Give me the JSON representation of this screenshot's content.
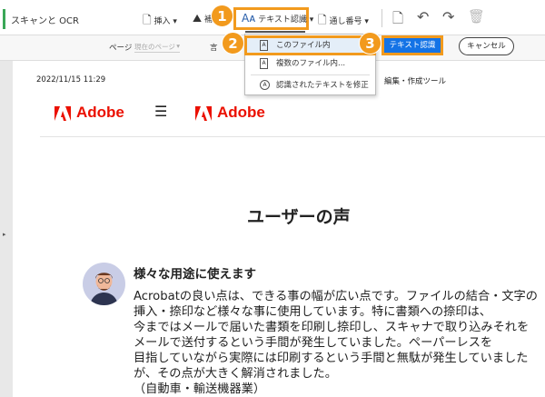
{
  "toolbar": {
    "title": "スキャンと OCR",
    "insert": "挿入",
    "enhance": "補",
    "recognize": "テキスト認識",
    "bates": "通し番号"
  },
  "subbar": {
    "page_label": "ページ",
    "page_value": "現在のページ",
    "lang_label": "言",
    "recognize_button": "テキスト認識",
    "cancel_button": "キャンセル"
  },
  "menu": {
    "items": [
      {
        "label": "このファイル内",
        "icon": "file-a-icon"
      },
      {
        "label": "複数のファイル内...",
        "icon": "files-a-icon"
      },
      {
        "label": "認識されたテキストを修正",
        "icon": "magnifier-a-icon"
      }
    ]
  },
  "steps": [
    "1",
    "2",
    "3"
  ],
  "doc": {
    "date": "2022/11/15 11:29",
    "header_right": "編集・作成ツール",
    "brand": "Adobe",
    "menu_glyph": "☰",
    "title": "ユーザーの声",
    "heading": "様々な用途に使えます",
    "lines": [
      "Acrobatの良い点は、できる事の幅が広い点です。ファイルの結合・文字の",
      "挿入・捺印など様々な事に使用しています。特に書類への捺印は、",
      "今まではメールで届いた書類を印刷し捺印し、スキャナで取り込みそれを",
      "メールで送付するという手間が発生していました。ペーパーレスを",
      "目指していながら実際には印刷するという手間と無駄が発生していました",
      "が、その点が大きく解消されました。",
      "（自動車・輸送機器業）"
    ]
  },
  "colors": {
    "accent": "#f29a1d",
    "blue": "#1473e6",
    "adobe_red": "#eb1000"
  }
}
